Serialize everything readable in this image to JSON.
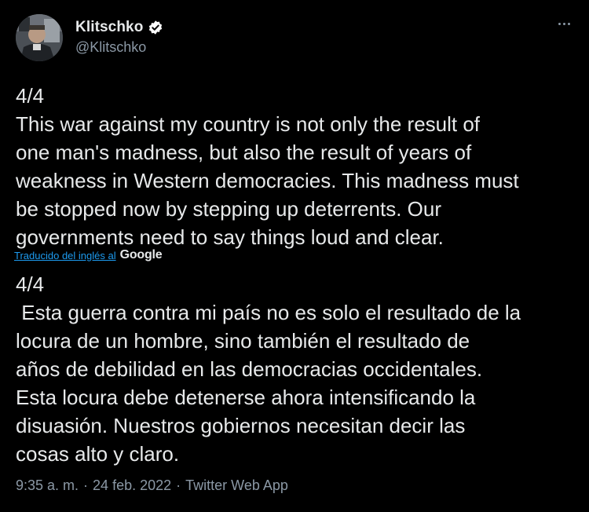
{
  "author": {
    "display_name": "Klitschko",
    "handle": "@Klitschko",
    "verified": true
  },
  "tweet": {
    "text": "4/4\nThis war against my country is not only the result of\none man's madness, but also the result of years of\nweakness in Western democracies. This madness must\nbe stopped now by stepping up deterrents. Our\ngovernments need to say things loud and clear."
  },
  "translation": {
    "link_text": "Traducido del inglés al",
    "provider": "Google",
    "text": "4/4\n Esta guerra contra mi país no es solo el resultado de la\nlocura de un hombre, sino también el resultado de\naños de debilidad en las democracias occidentales.\nEsta locura debe detenerse ahora intensificando la\ndisuasión. Nuestros gobiernos necesitan decir las\ncosas alto y claro."
  },
  "meta": {
    "time": "9:35 a. m.",
    "separator": "·",
    "date": "24 feb. 2022",
    "source": "Twitter Web App"
  },
  "icons": {
    "verified": "verified-badge-icon",
    "more": "more-options-icon"
  },
  "colors": {
    "background": "#000000",
    "text": "#e7e9ea",
    "secondary": "#8b98a5",
    "link": "#1d9bf0"
  }
}
